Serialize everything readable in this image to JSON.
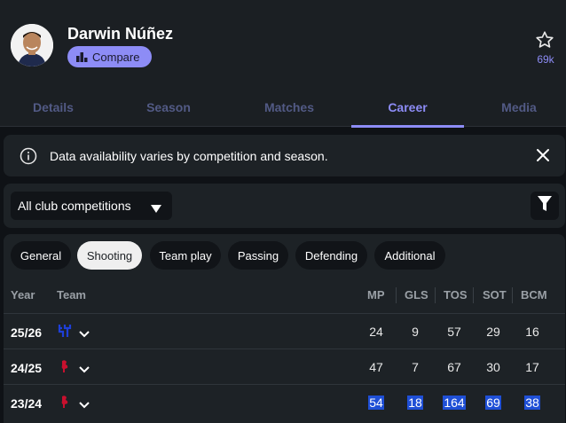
{
  "player": {
    "name": "Darwin Núñez",
    "compare_label": "Compare",
    "followers": "69k"
  },
  "tabs": [
    {
      "label": "Details",
      "active": false
    },
    {
      "label": "Season",
      "active": false
    },
    {
      "label": "Matches",
      "active": false
    },
    {
      "label": "Career",
      "active": true
    },
    {
      "label": "Media",
      "active": false
    }
  ],
  "notice": {
    "text": "Data availability varies by competition and season."
  },
  "filter": {
    "competition": "All club competitions"
  },
  "stat_tabs": [
    {
      "label": "General",
      "active": false
    },
    {
      "label": "Shooting",
      "active": true
    },
    {
      "label": "Team play",
      "active": false
    },
    {
      "label": "Passing",
      "active": false
    },
    {
      "label": "Defending",
      "active": false
    },
    {
      "label": "Additional",
      "active": false
    }
  ],
  "table": {
    "headers": {
      "year": "Year",
      "team": "Team",
      "mp": "MP",
      "gls": "GLS",
      "tos": "TOS",
      "sot": "SOT",
      "bcm": "BCM"
    },
    "rows": [
      {
        "year": "25/26",
        "team_icon": "al-hilal-crest-icon",
        "mp": "24",
        "gls": "9",
        "tos": "57",
        "sot": "29",
        "bcm": "16",
        "highlighted": false
      },
      {
        "year": "24/25",
        "team_icon": "liverpool-crest-icon",
        "mp": "47",
        "gls": "7",
        "tos": "67",
        "sot": "30",
        "bcm": "17",
        "highlighted": false
      },
      {
        "year": "23/24",
        "team_icon": "liverpool-crest-icon",
        "mp": "54",
        "gls": "18",
        "tos": "164",
        "sot": "69",
        "bcm": "38",
        "highlighted": true
      }
    ]
  },
  "colors": {
    "accent": "#8d8cf6",
    "background": "#0f1216",
    "panel": "#1d2226",
    "highlight": "#1f4fd6",
    "liverpool": "#c8102e",
    "al_hilal": "#1e3fd8"
  }
}
